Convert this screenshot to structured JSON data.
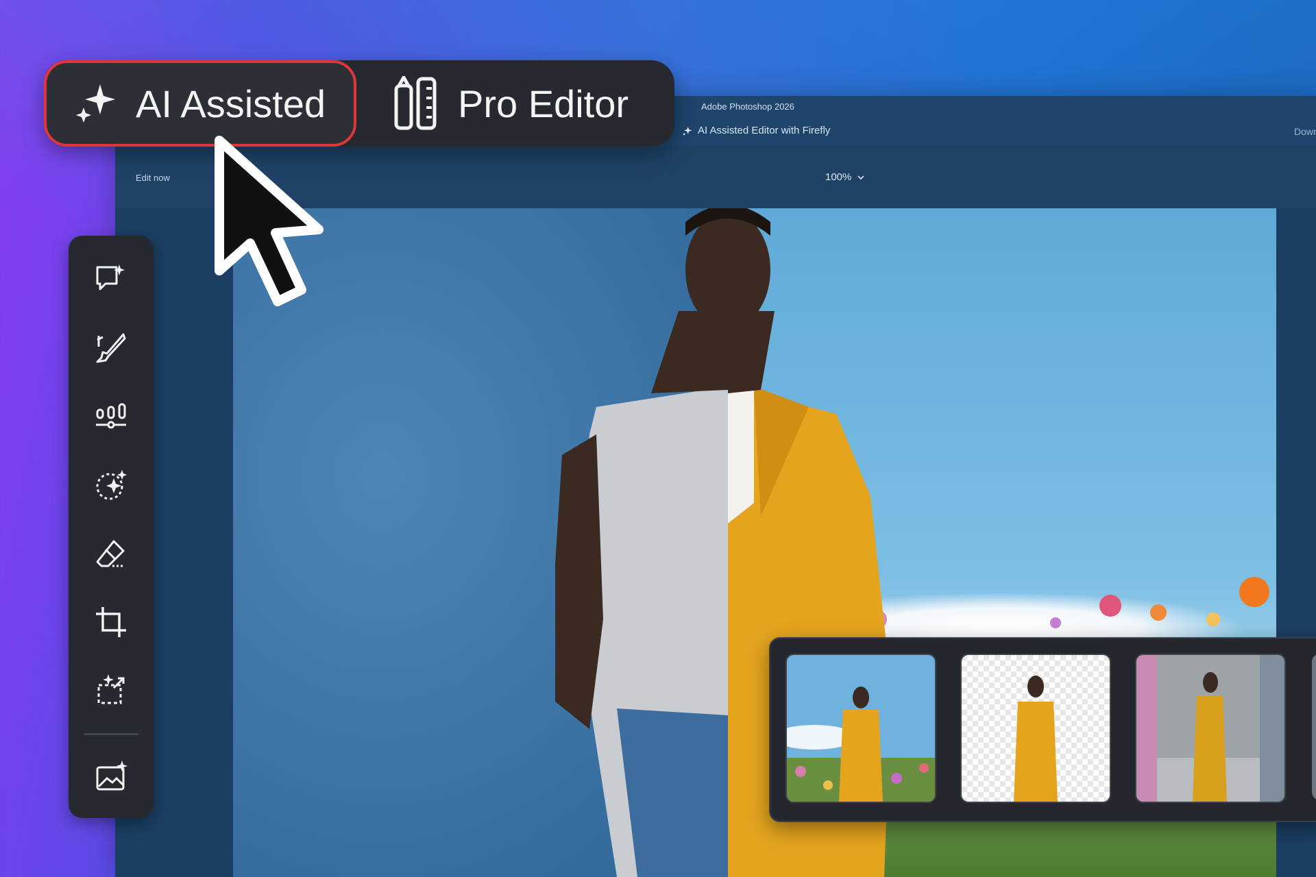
{
  "mode_switcher": {
    "ai_label": "AI Assisted",
    "pro_label": "Pro Editor",
    "selected": "AI Assisted"
  },
  "app": {
    "name": "Adobe Photoshop 2026",
    "subtitle": "AI Assisted Editor with Firefly",
    "download_text": "Downli"
  },
  "toolbar": {
    "edit_now": "Edit now",
    "zoom": "100%"
  },
  "tools": [
    {
      "icon": "chat-sparkle-icon"
    },
    {
      "icon": "brush-icon"
    },
    {
      "icon": "adjustments-icon"
    },
    {
      "icon": "select-sparkle-icon"
    },
    {
      "icon": "eraser-icon"
    },
    {
      "icon": "crop-icon"
    },
    {
      "icon": "expand-sparkle-icon"
    },
    {
      "icon": "generate-image-icon"
    }
  ],
  "variations": [
    {
      "name": "flowers-field"
    },
    {
      "name": "transparent-background"
    },
    {
      "name": "concrete-room"
    }
  ],
  "colors": {
    "accent_red": "#e0353a",
    "panel_dark": "#262a30",
    "suit_yellow": "#e6a51f"
  }
}
